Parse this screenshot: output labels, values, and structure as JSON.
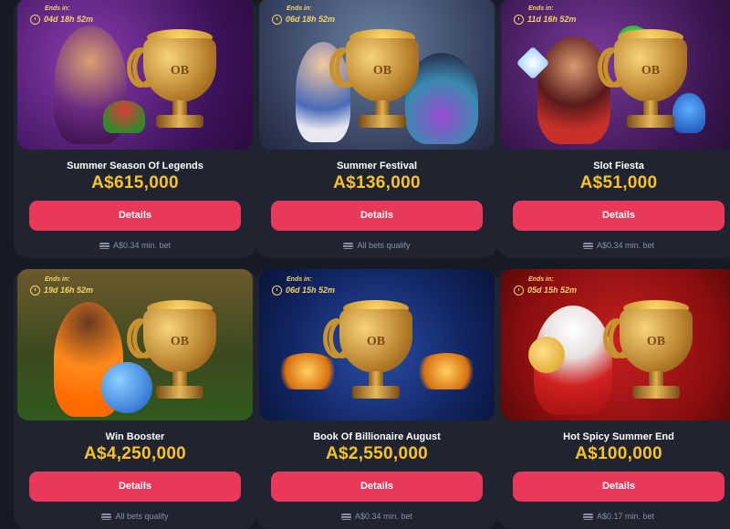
{
  "ends_label": "Ends in:",
  "details_label": "Details",
  "colors": {
    "accent_button": "#e9385a",
    "prize": "#f7c325",
    "timer": "#f5d36a"
  },
  "icons": {
    "timer": "stopwatch-icon",
    "bet": "coins-icon",
    "trophy": "trophy-icon"
  },
  "cards": [
    {
      "ends_time": "04d 18h 52m",
      "title": "Summer Season Of Legends",
      "prize": "A$615,000",
      "bet": "A$0.34 min. bet"
    },
    {
      "ends_time": "06d 18h 52m",
      "title": "Summer Festival",
      "prize": "A$136,000",
      "bet": "All bets qualify"
    },
    {
      "ends_time": "11d 16h 52m",
      "title": "Slot Fiesta",
      "prize": "A$51,000",
      "bet": "A$0.34 min. bet"
    },
    {
      "ends_time": "19d 16h 52m",
      "title": "Win Booster",
      "prize": "A$4,250,000",
      "bet": "All bets qualify"
    },
    {
      "ends_time": "06d 15h 52m",
      "title": "Book Of Billionaire August",
      "prize": "A$2,550,000",
      "bet": "A$0.34 min. bet"
    },
    {
      "ends_time": "05d 15h 52m",
      "title": "Hot Spicy Summer End",
      "prize": "A$100,000",
      "bet": "A$0.17 min. bet"
    }
  ]
}
